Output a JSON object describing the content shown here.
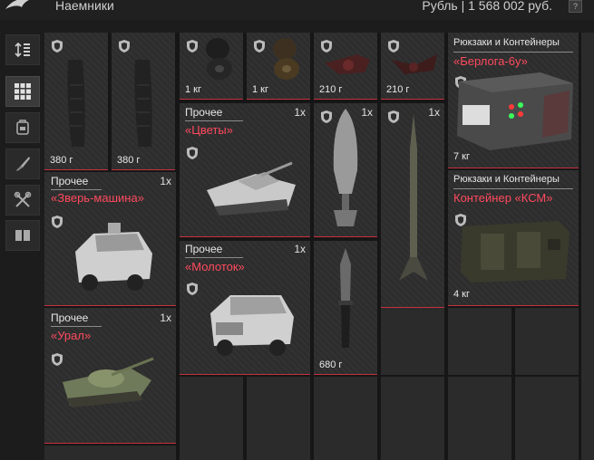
{
  "header": {
    "title": "Наемники",
    "balance": "Рубль | 1 568 002 руб.",
    "help": "?"
  },
  "sidebar": [
    {
      "name": "sort-button",
      "icon": "sort-icon"
    },
    {
      "name": "grid-view-button",
      "icon": "grid-icon",
      "active": true
    },
    {
      "name": "backpack-filter-button",
      "icon": "backpack-icon"
    },
    {
      "name": "weapon-filter-button",
      "icon": "knife-icon"
    },
    {
      "name": "tools-filter-button",
      "icon": "tools-icon"
    },
    {
      "name": "container-filter-button",
      "icon": "container-icon"
    }
  ],
  "items": {
    "mag1": {
      "weight": "380 г"
    },
    "mag2": {
      "weight": "380 г"
    },
    "tire1": {
      "weight": "1 кг"
    },
    "tire2": {
      "weight": "1 кг"
    },
    "tool1": {
      "weight": "210 г"
    },
    "tool2": {
      "weight": "210 г"
    },
    "zver": {
      "category": "Прочее",
      "name": "«Зверь-машина»",
      "qty": "1x"
    },
    "ural": {
      "category": "Прочее",
      "name": "«Урал»",
      "qty": "1x"
    },
    "tsvety": {
      "category": "Прочее",
      "name": "«Цветы»",
      "qty": "1x"
    },
    "molotok": {
      "category": "Прочее",
      "name": "«Молоток»",
      "qty": "1x"
    },
    "bomb": {
      "qty": "1x"
    },
    "rod": {
      "qty": "1x"
    },
    "knife": {
      "weight": "680 г"
    },
    "berloga": {
      "category": "Рюкзаки и Контейнеры",
      "name": "«Берлога-6у»",
      "weight": "7 кг"
    },
    "ksm": {
      "category": "Рюкзаки и Контейнеры",
      "name": "Контейнер «КСМ»",
      "weight": "4 кг"
    }
  }
}
